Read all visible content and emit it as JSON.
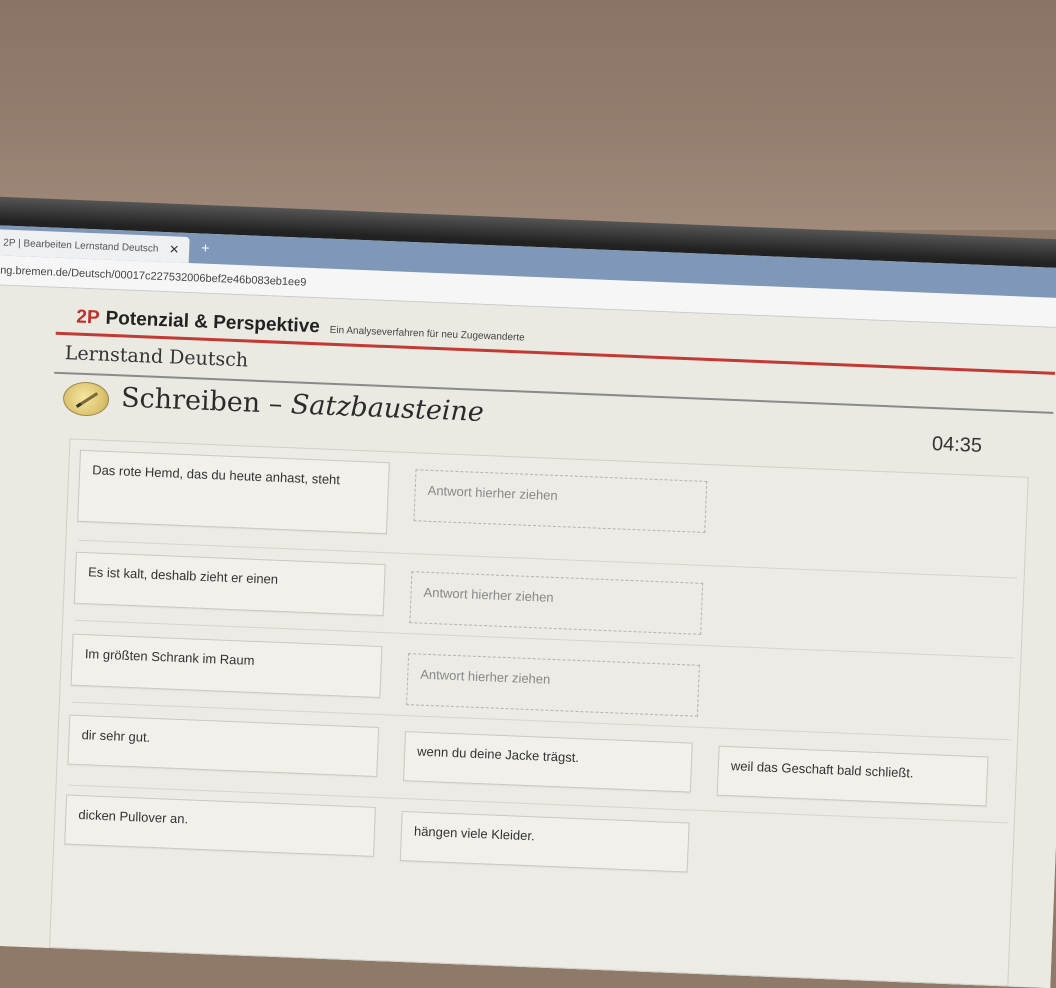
{
  "browser": {
    "tab_title": "2P | Bearbeiten Lernstand Deutsch",
    "tab_close": "✕",
    "new_tab": "+",
    "url": "ng.bremen.de/Deutsch/00017c227532006bef2e46b083eb1ee9"
  },
  "header": {
    "logo": "2P",
    "brand": "Potenzial & Perspektive",
    "tagline": "Ein Analyseverfahren für neu Zugewanderte"
  },
  "section": {
    "title": "Lernstand Deutsch"
  },
  "task": {
    "title_part1": "Schreiben – ",
    "title_part2": "Satzbausteine",
    "timer": "04:35"
  },
  "sentences": [
    {
      "text": "Das rote Hemd, das du heute anhast, steht",
      "drop": "Antwort hierher ziehen"
    },
    {
      "text": "Es ist kalt, deshalb zieht er einen",
      "drop": "Antwort hierher ziehen"
    },
    {
      "text": "Im größten Schrank im Raum",
      "drop": "Antwort hierher ziehen"
    }
  ],
  "options": [
    "dir sehr gut.",
    "wenn du deine Jacke trägst.",
    "weil das Geschaft bald schließt.",
    "dicken Pullover an.",
    "hängen viele Kleider."
  ]
}
